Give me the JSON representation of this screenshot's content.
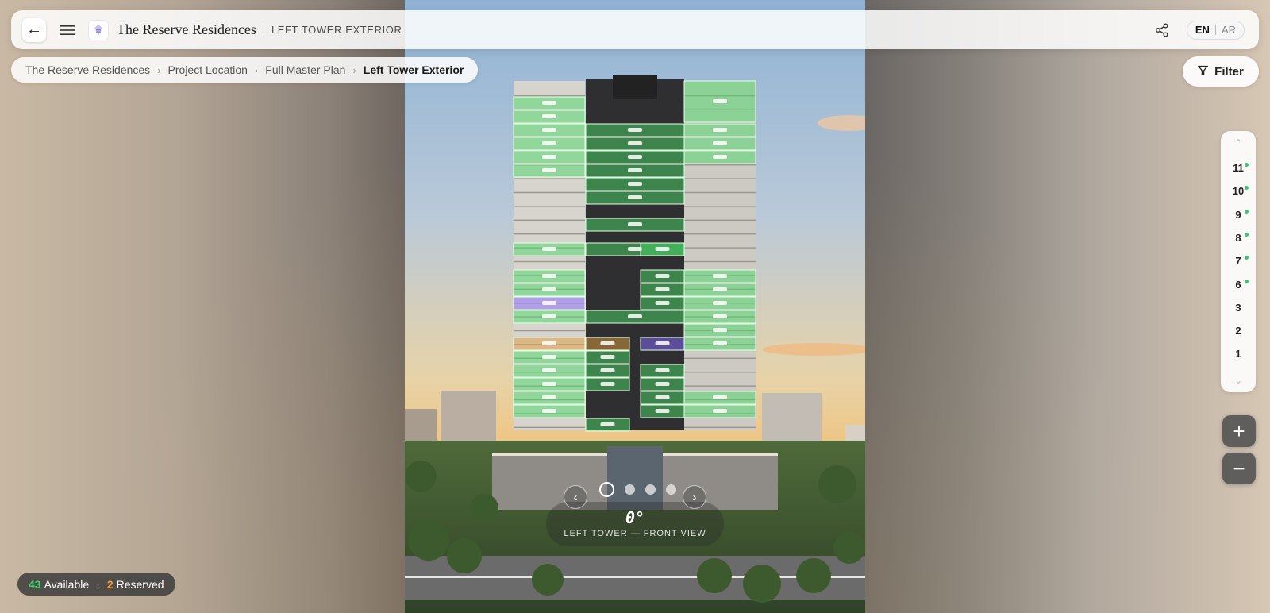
{
  "header": {
    "title": "The Reserve Residences",
    "subtitle": "LEFT TOWER EXTERIOR",
    "back_icon": "arrow-left-icon",
    "menu_icon": "hamburger-menu-icon",
    "share_icon": "share-icon",
    "languages": [
      {
        "code": "EN",
        "active": true
      },
      {
        "code": "AR",
        "active": false
      }
    ]
  },
  "breadcrumb": [
    {
      "label": "The Reserve Residences"
    },
    {
      "label": "Project Location"
    },
    {
      "label": "Full Master Plan"
    },
    {
      "label": "Left Tower Exterior",
      "current": true
    }
  ],
  "filter": {
    "label": "Filter",
    "icon": "funnel-icon"
  },
  "floor_selector": {
    "up_icon": "chevron-up-icon",
    "down_icon": "chevron-down-icon",
    "floors": [
      {
        "label": "11",
        "available": true
      },
      {
        "label": "10",
        "available": true
      },
      {
        "label": "9",
        "available": true
      },
      {
        "label": "8",
        "available": true
      },
      {
        "label": "7",
        "available": true
      },
      {
        "label": "6",
        "available": true
      },
      {
        "label": "3",
        "available": false
      },
      {
        "label": "2",
        "available": false
      },
      {
        "label": "1",
        "available": false
      }
    ]
  },
  "zoom": {
    "in_icon": "plus-icon",
    "out_icon": "minus-icon"
  },
  "status": {
    "available_count": "43",
    "available_label": "Available",
    "reserved_count": "2",
    "reserved_label": "Reserved"
  },
  "view": {
    "angle": "0°",
    "name": "LEFT TOWER — FRONT VIEW",
    "total_views": 4,
    "active_index": 0,
    "prev_icon": "chevron-left-icon",
    "next_icon": "chevron-right-icon"
  },
  "colors": {
    "available": "#4cd96a",
    "reserved": "#f0a030",
    "held": "#8a6cff",
    "selected": "#e0a040"
  }
}
